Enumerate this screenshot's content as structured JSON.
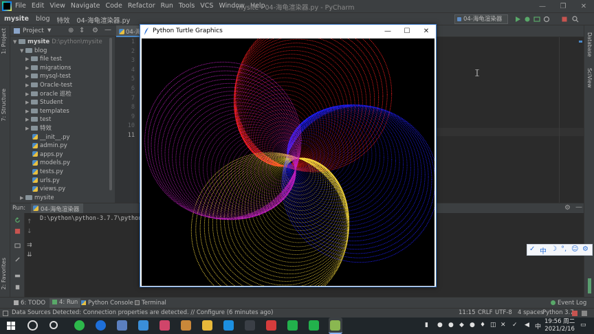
{
  "ide": {
    "menu": [
      "File",
      "Edit",
      "View",
      "Navigate",
      "Code",
      "Refactor",
      "Run",
      "Tools",
      "VCS",
      "Window",
      "Help"
    ],
    "window_title": "mysite - 04-海龟渲染器.py - PyCharm",
    "breadcrumbs": [
      "mysite",
      "blog",
      "特效",
      "04-海龟渲染器.py"
    ],
    "run_config": "04-海龟渲染器",
    "left_tabs": [
      "1: Project",
      "7: Structure",
      "2: Favorites"
    ],
    "right_tabs": [
      "Database",
      "SciView"
    ]
  },
  "project": {
    "title": "Project",
    "root_name": "mysite",
    "root_path": "D:\\python\\mysite",
    "folder_blog": "blog",
    "folders": [
      "file test",
      "migrations",
      "mysql-test",
      "Oracle-test",
      "oracle 巡检",
      "Student",
      "templates",
      "test",
      "特效"
    ],
    "files": [
      "__init__.py",
      "admin.py",
      "apps.py",
      "models.py",
      "tests.py",
      "urls.py",
      "views.py"
    ],
    "next_folder": "mysite"
  },
  "editor": {
    "tab_label": "04-海",
    "line_numbers": [
      "1",
      "2",
      "3",
      "4",
      "5",
      "6",
      "7",
      "8",
      "9",
      "10",
      "11"
    ]
  },
  "run": {
    "label": "Run:",
    "tab": "04-海龟渲染器",
    "console": "D:\\python\\python-3.7.7\\python"
  },
  "tool_tabs": {
    "todo": "6: TODO",
    "run": "4: Run",
    "python_console": "Python Console",
    "terminal": "Terminal",
    "event_log": "Event Log"
  },
  "status": {
    "message": "Data Sources Detected: Connection properties are detected. // Configure (6 minutes ago)",
    "position": "11:15",
    "line_sep": "CRLF",
    "encoding": "UTF-8",
    "indent": "4 spaces",
    "interpreter": "Python 3.7"
  },
  "turtle": {
    "title": "Python Turtle Graphics",
    "ctl_min": "—",
    "ctl_max": "☐",
    "ctl_close": "✕",
    "colors": [
      "#ff2020",
      "#2020ff",
      "#ffe040",
      "#c020c0"
    ]
  },
  "ime": {
    "zh": "中"
  },
  "taskbar": {
    "time": "19:56 周二",
    "date": "2021/2/16"
  }
}
